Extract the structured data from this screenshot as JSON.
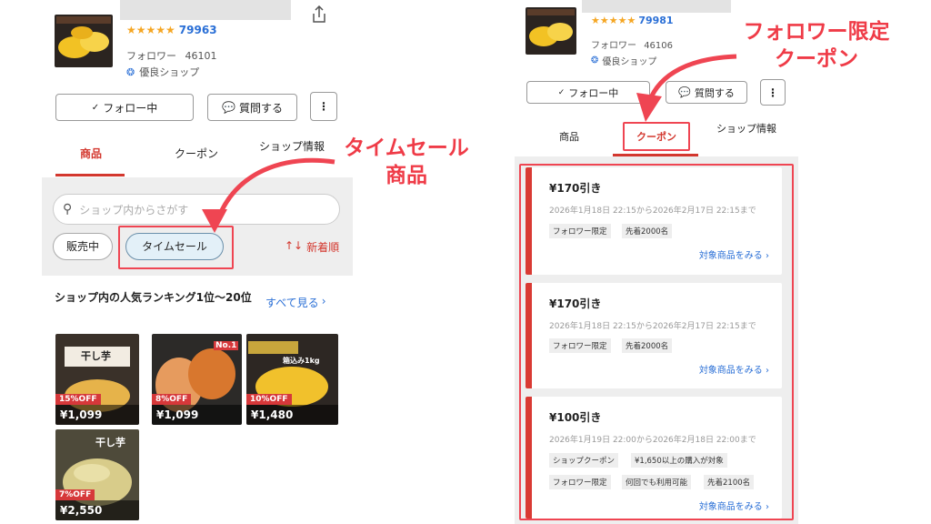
{
  "left": {
    "shop": {
      "rating_stars": "★★★★★",
      "rating_count": "79963",
      "followers_label": "フォロワー",
      "followers_count": "46101",
      "badge": "優良ショップ"
    },
    "follow_button": "フォロー中",
    "follow_check": "✓",
    "question_button": "質問する",
    "tabs": [
      "商品",
      "クーポン",
      "ショップ情報"
    ],
    "search_placeholder": "ショップ内からさがす",
    "filters": {
      "on_sale": "販売中",
      "time_sale": "タイムセール"
    },
    "sort": {
      "icon": "↑↓",
      "label": "新着順"
    },
    "ranking": {
      "title": "ショップ内の人気ランキング1位〜20位",
      "see_all": "すべて見る"
    },
    "products": [
      {
        "discount": "15%OFF",
        "price": "¥1,099",
        "overlay": "干し芋"
      },
      {
        "discount": "8%OFF",
        "price": "¥1,099",
        "overlay": "No.1"
      },
      {
        "discount": "10%OFF",
        "price": "¥1,480",
        "overlay": "箱込み1kg"
      },
      {
        "discount": "7%OFF",
        "price": "¥2,550",
        "overlay": "干し芋"
      }
    ],
    "annotation": [
      "タイムセール",
      "商品"
    ]
  },
  "right": {
    "shop": {
      "rating_stars": "★★★★★",
      "rating_count": "79981",
      "followers_label": "フォロワー",
      "followers_count": "46106",
      "badge": "優良ショップ"
    },
    "follow_button": "フォロー中",
    "follow_check": "✓",
    "question_button": "質問する",
    "tabs": [
      "商品",
      "クーポン",
      "ショップ情報"
    ],
    "annotation": [
      "フォロワー限定",
      "クーポン"
    ],
    "coupons": [
      {
        "title": "¥170引き",
        "date": "2026年1月18日 22:15から2026年2月17日 22:15まで",
        "tags_row1": [
          "フォロワー限定",
          "先着2000名"
        ],
        "link": "対象商品をみる"
      },
      {
        "title": "¥170引き",
        "date": "2026年1月18日 22:15から2026年2月17日 22:15まで",
        "tags_row1": [
          "フォロワー限定",
          "先着2000名"
        ],
        "link": "対象商品をみる"
      },
      {
        "title": "¥100引き",
        "date": "2026年1月19日 22:00から2026年2月18日 22:00まで",
        "tags_row1": [
          "ショップクーポン",
          "¥1,650以上の購入が対象"
        ],
        "tags_row2": [
          "フォロワー限定",
          "何回でも利用可能",
          "先着2100名"
        ],
        "link": "対象商品をみる"
      }
    ]
  },
  "colors": {
    "accent_red": "#d3372e",
    "annotation_red": "#ef3b47",
    "link_blue": "#2a6fd6",
    "star_gold": "#f5a623"
  }
}
